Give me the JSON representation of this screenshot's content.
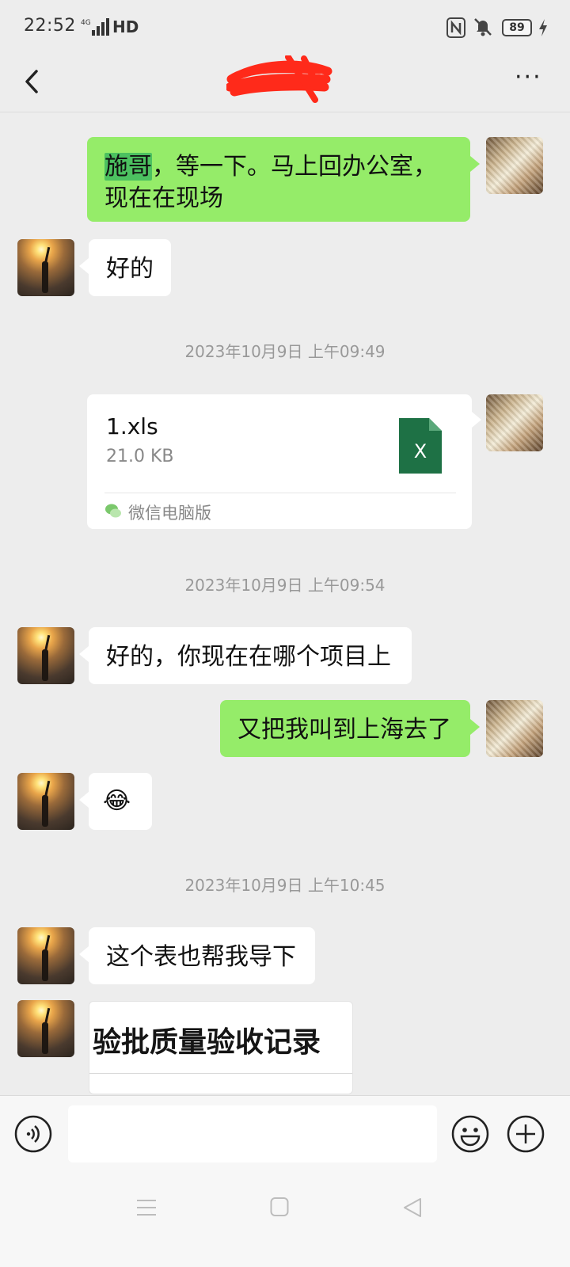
{
  "status_bar": {
    "time": "22:52",
    "network": "4G",
    "hd": "HD",
    "battery": "89"
  },
  "header": {
    "title_redacted": true,
    "back_icon": "chevron-left-icon",
    "more_label": "···"
  },
  "messages": [
    {
      "side": "me",
      "text_highlight": "施哥",
      "text_rest": "，等一下。马上回办公室，现在在现场"
    },
    {
      "side": "them",
      "text": "好的"
    },
    {
      "timestamp": "2023年10月9日 上午09:49"
    },
    {
      "side": "me",
      "type": "file",
      "file_name": "1.xls",
      "file_size": "21.0 KB",
      "file_icon_letter": "X",
      "source": "微信电脑版"
    },
    {
      "timestamp": "2023年10月9日 上午09:54"
    },
    {
      "side": "them",
      "text": "好的，你现在在哪个项目上"
    },
    {
      "side": "me",
      "text": "又把我叫到上海去了"
    },
    {
      "side": "them",
      "text": "😂"
    },
    {
      "timestamp": "2023年10月9日 上午10:45"
    },
    {
      "side": "them",
      "text": "这个表也帮我导下"
    },
    {
      "side": "them",
      "type": "image",
      "image_text": "验批质量验收记录"
    }
  ],
  "input_bar": {
    "voice_icon": "voice-icon",
    "emoji_icon": "emoji-icon",
    "plus_icon": "plus-icon",
    "placeholder": ""
  },
  "colors": {
    "my_bubble": "#95ec69",
    "their_bubble": "#ffffff",
    "background": "#ededed",
    "file_icon": "#1e7145",
    "redaction": "#ff2a1a"
  }
}
